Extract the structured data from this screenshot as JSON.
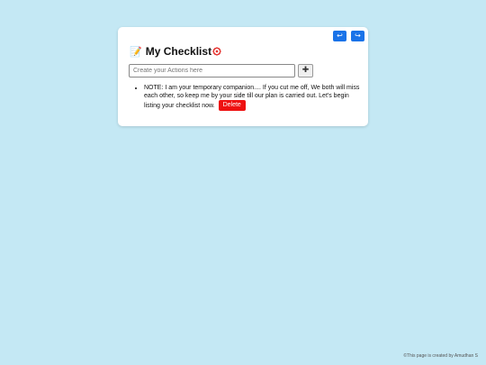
{
  "nav": {
    "undo_glyph": "↩",
    "redo_glyph": "↪",
    "undo_icon": "undo-arrow-icon",
    "redo_icon": "redo-arrow-icon"
  },
  "header": {
    "title": "My Checklist",
    "lead_emoji": "📝",
    "lead_icon": "memo-icon",
    "trail_icon": "target-icon"
  },
  "input": {
    "placeholder": "Create your Actions here",
    "value": "",
    "add_glyph": "✚",
    "add_icon": "plus-icon"
  },
  "items": [
    {
      "text": "NOTE: I am your temporary companion.... If you cut me off, We both will miss each other, so keep me by your side till our plan is carried out. Let's begin listing your checklist now.",
      "delete_label": "Delete"
    }
  ],
  "footer": {
    "credit": "©This page is created by Amudhan S"
  },
  "colors": {
    "background": "#c4e8f4",
    "nav_button": "#1a73e8",
    "delete_button": "#ee1111"
  }
}
